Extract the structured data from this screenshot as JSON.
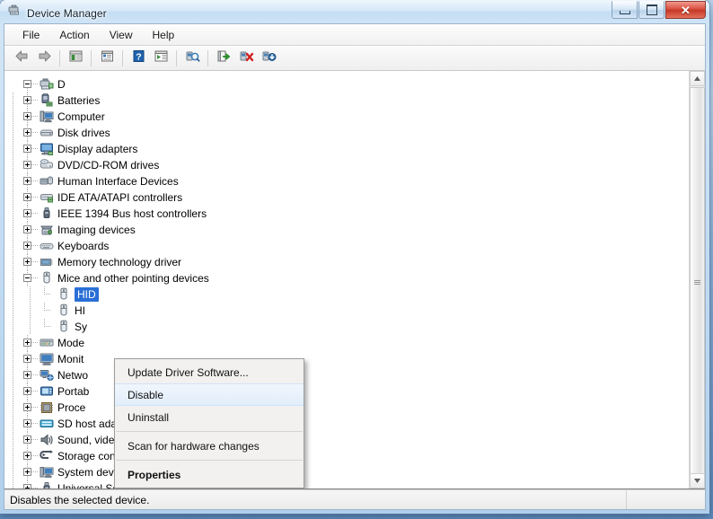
{
  "window": {
    "title": "Device Manager",
    "app_icon": "device-manager-icon",
    "controls": {
      "minimize": "Minimize",
      "maximize": "Maximize",
      "close": "Close",
      "close_glyph": "✕"
    }
  },
  "menubar": {
    "items": [
      {
        "label": "File",
        "name": "menu-file"
      },
      {
        "label": "Action",
        "name": "menu-action"
      },
      {
        "label": "View",
        "name": "menu-view"
      },
      {
        "label": "Help",
        "name": "menu-help"
      }
    ]
  },
  "toolbar": {
    "buttons": [
      {
        "name": "back-button",
        "icon": "arrow-left-icon",
        "tip": "Back"
      },
      {
        "name": "forward-button",
        "icon": "arrow-right-icon",
        "tip": "Forward"
      },
      {
        "name": "show-hide-console-tree-button",
        "icon": "console-tree-icon",
        "tip": "Show/Hide Console Tree"
      },
      {
        "name": "properties-button",
        "icon": "properties-window-icon",
        "tip": "Properties"
      },
      {
        "name": "help-button",
        "icon": "help-question-icon",
        "tip": "Help"
      },
      {
        "name": "view-button",
        "icon": "view-pane-icon",
        "tip": "View"
      },
      {
        "name": "scan-hardware-changes-button",
        "icon": "scan-hardware-icon",
        "tip": "Scan for hardware changes"
      },
      {
        "name": "update-driver-button",
        "icon": "update-driver-icon",
        "tip": "Update Driver Software"
      },
      {
        "name": "uninstall-device-button",
        "icon": "uninstall-device-icon",
        "tip": "Uninstall"
      },
      {
        "name": "disable-device-button",
        "icon": "disable-device-icon",
        "tip": "Disable"
      }
    ]
  },
  "tree": {
    "root": {
      "label": "D",
      "icon": "computer-root-icon",
      "expanded": true
    },
    "nodes": [
      {
        "label": "Batteries",
        "icon": "battery-icon",
        "expander": "plus",
        "depth": 1
      },
      {
        "label": "Computer",
        "icon": "computer-icon",
        "expander": "plus",
        "depth": 1
      },
      {
        "label": "Disk drives",
        "icon": "disk-drive-icon",
        "expander": "plus",
        "depth": 1
      },
      {
        "label": "Display adapters",
        "icon": "display-adapter-icon",
        "expander": "plus",
        "depth": 1
      },
      {
        "label": "DVD/CD-ROM drives",
        "icon": "dvd-drive-icon",
        "expander": "plus",
        "depth": 1
      },
      {
        "label": "Human Interface Devices",
        "icon": "hid-icon",
        "expander": "plus",
        "depth": 1
      },
      {
        "label": "IDE ATA/ATAPI controllers",
        "icon": "ide-controller-icon",
        "expander": "plus",
        "depth": 1
      },
      {
        "label": "IEEE 1394 Bus host controllers",
        "icon": "ieee1394-icon",
        "expander": "plus",
        "depth": 1
      },
      {
        "label": "Imaging devices",
        "icon": "imaging-device-icon",
        "expander": "plus",
        "depth": 1
      },
      {
        "label": "Keyboards",
        "icon": "keyboard-icon",
        "expander": "plus",
        "depth": 1
      },
      {
        "label": "Memory technology driver",
        "icon": "memory-technology-icon",
        "expander": "plus",
        "depth": 1
      },
      {
        "label": "Mice and other pointing devices",
        "icon": "mouse-icon",
        "expander": "minus",
        "depth": 1
      },
      {
        "label": "HID",
        "icon": "mouse-icon",
        "expander": "none",
        "depth": 2,
        "selected": true,
        "truncated": true
      },
      {
        "label": "HI",
        "icon": "mouse-icon",
        "expander": "none",
        "depth": 2,
        "truncated": true
      },
      {
        "label": "Sy",
        "icon": "mouse-icon",
        "expander": "none",
        "depth": 2,
        "truncated": true
      },
      {
        "label": "Mode",
        "icon": "modem-icon",
        "expander": "plus",
        "depth": 1,
        "truncated": true
      },
      {
        "label": "Monit",
        "icon": "monitor-icon",
        "expander": "plus",
        "depth": 1,
        "truncated": true
      },
      {
        "label": "Netwo",
        "icon": "network-adapter-icon",
        "expander": "plus",
        "depth": 1,
        "truncated": true
      },
      {
        "label": "Portab",
        "icon": "portable-device-icon",
        "expander": "plus",
        "depth": 1,
        "truncated": true
      },
      {
        "label": "Proce",
        "icon": "processor-icon",
        "expander": "plus",
        "depth": 1,
        "truncated": true
      },
      {
        "label": "SD host adapters",
        "icon": "sd-host-adapter-icon",
        "expander": "plus",
        "depth": 1
      },
      {
        "label": "Sound, video and game controllers",
        "icon": "sound-icon",
        "expander": "plus",
        "depth": 1
      },
      {
        "label": "Storage controllers",
        "icon": "storage-controller-icon",
        "expander": "plus",
        "depth": 1
      },
      {
        "label": "System devices",
        "icon": "system-device-icon",
        "expander": "plus",
        "depth": 1
      },
      {
        "label": "Universal Serial Bus controllers",
        "icon": "usb-controller-icon",
        "expander": "plus",
        "depth": 1
      }
    ]
  },
  "context_menu": {
    "items": [
      {
        "label": "Update Driver Software...",
        "name": "ctx-update-driver-software",
        "state": "normal"
      },
      {
        "label": "Disable",
        "name": "ctx-disable",
        "state": "hover"
      },
      {
        "label": "Uninstall",
        "name": "ctx-uninstall",
        "state": "normal"
      },
      {
        "separator": true
      },
      {
        "label": "Scan for hardware changes",
        "name": "ctx-scan-for-hardware-changes",
        "state": "normal"
      },
      {
        "separator": true
      },
      {
        "label": "Properties",
        "name": "ctx-properties",
        "state": "default"
      }
    ]
  },
  "statusbar": {
    "message": "Disables the selected device."
  },
  "colors": {
    "selection_blue": "#2a6fd6",
    "close_button_red": "#c53725",
    "menu_bg": "#f2f1f0",
    "hover_blue": "#e2eefb",
    "tree_bg": "#ffffff"
  }
}
